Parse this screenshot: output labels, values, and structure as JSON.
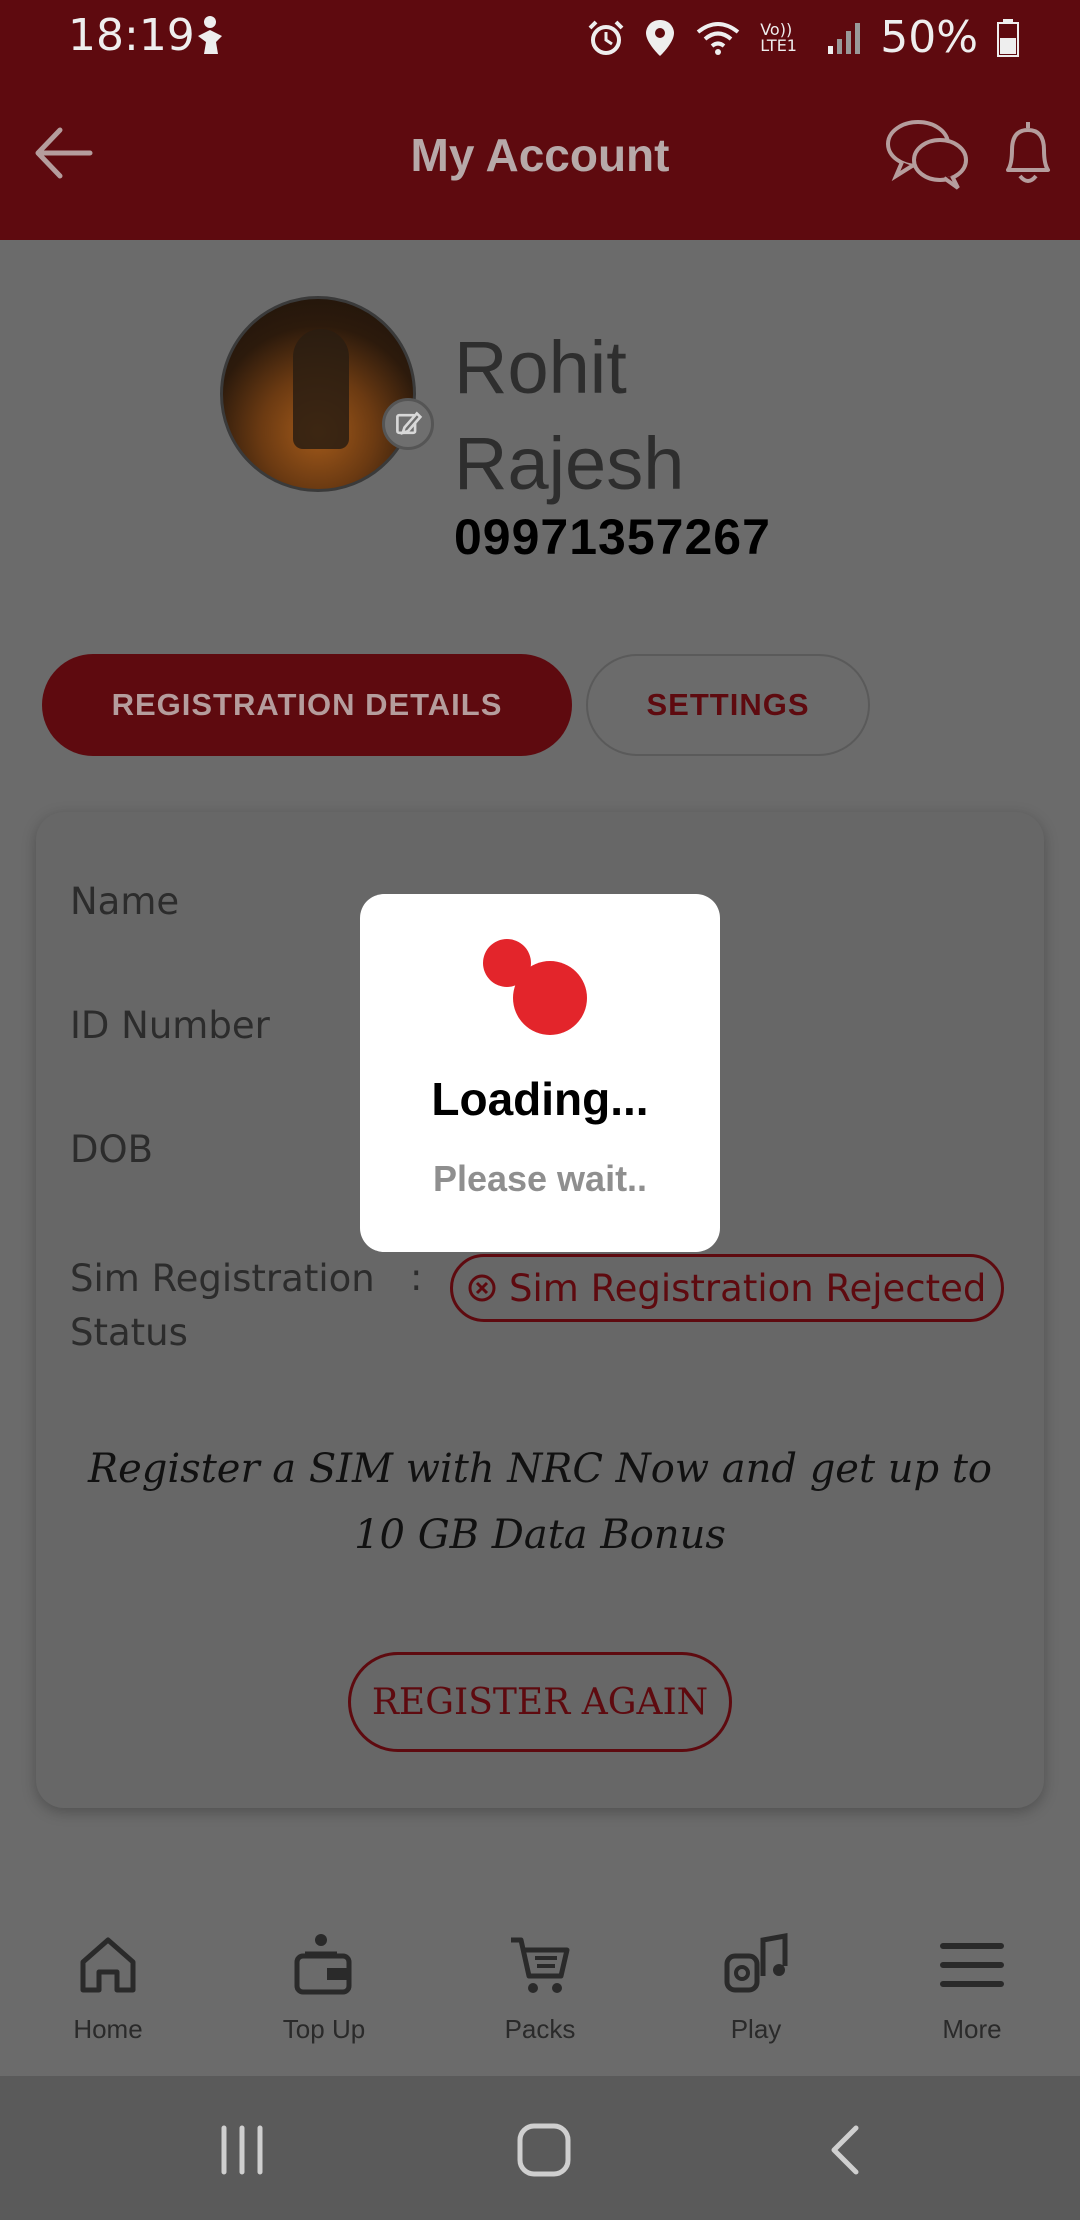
{
  "status_bar": {
    "time": "18:19",
    "network": "Vo)) LTE1",
    "battery": "50%"
  },
  "header": {
    "title": "My Account"
  },
  "profile": {
    "first_name": "Rohit",
    "last_name": "Rajesh",
    "phone": "09971357267"
  },
  "tabs": [
    {
      "label": "REGISTRATION DETAILS",
      "active": true
    },
    {
      "label": "SETTINGS",
      "active": false
    }
  ],
  "details": {
    "rows": [
      {
        "label": "Name"
      },
      {
        "label": "ID Number"
      },
      {
        "label": "DOB"
      },
      {
        "label": "Sim Registration Status"
      }
    ],
    "colon": ":",
    "status_value": "Sim Registration Rejected",
    "promo": "Register a SIM with NRC Now and get up to 10 GB Data Bonus",
    "register_button": "REGISTER AGAIN"
  },
  "dialog": {
    "title": "Loading...",
    "subtitle": "Please wait.."
  },
  "bottom_nav": [
    {
      "label": "Home",
      "icon": "home-icon"
    },
    {
      "label": "Top Up",
      "icon": "wallet-icon"
    },
    {
      "label": "Packs",
      "icon": "cart-icon"
    },
    {
      "label": "Play",
      "icon": "music-icon"
    },
    {
      "label": "More",
      "icon": "menu-icon"
    }
  ],
  "colors": {
    "brand": "#e3252b",
    "header": "#5e0a0f",
    "overlay": "#6b6b6b"
  }
}
